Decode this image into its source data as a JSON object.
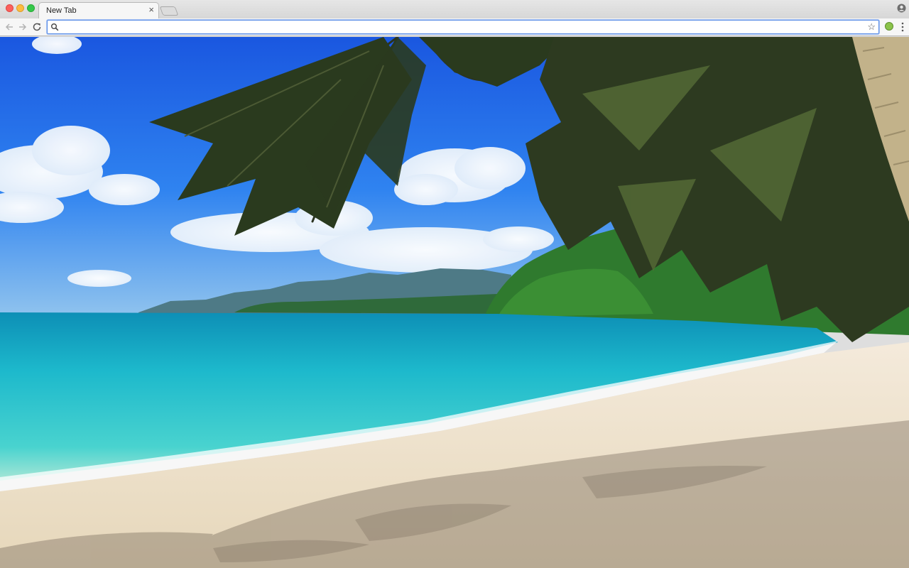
{
  "window": {
    "tab": {
      "title": "New Tab",
      "close_glyph": "×"
    },
    "new_tab_icon": "new-tab-icon"
  },
  "toolbar": {
    "back_icon": "arrow-left-icon",
    "forward_icon": "arrow-right-icon",
    "reload_icon": "reload-icon",
    "omnibox": {
      "value": "",
      "placeholder": ""
    },
    "star_glyph": "☆",
    "extension_icon": "extension-icon",
    "menu_icon": "menu-dots-icon"
  },
  "colors": {
    "sky": "#1f6ff0",
    "sea": "#27c7d3",
    "sand": "#eee4cf",
    "palm": "#2f3b22",
    "omnibox_focus": "#5b8ee6"
  }
}
